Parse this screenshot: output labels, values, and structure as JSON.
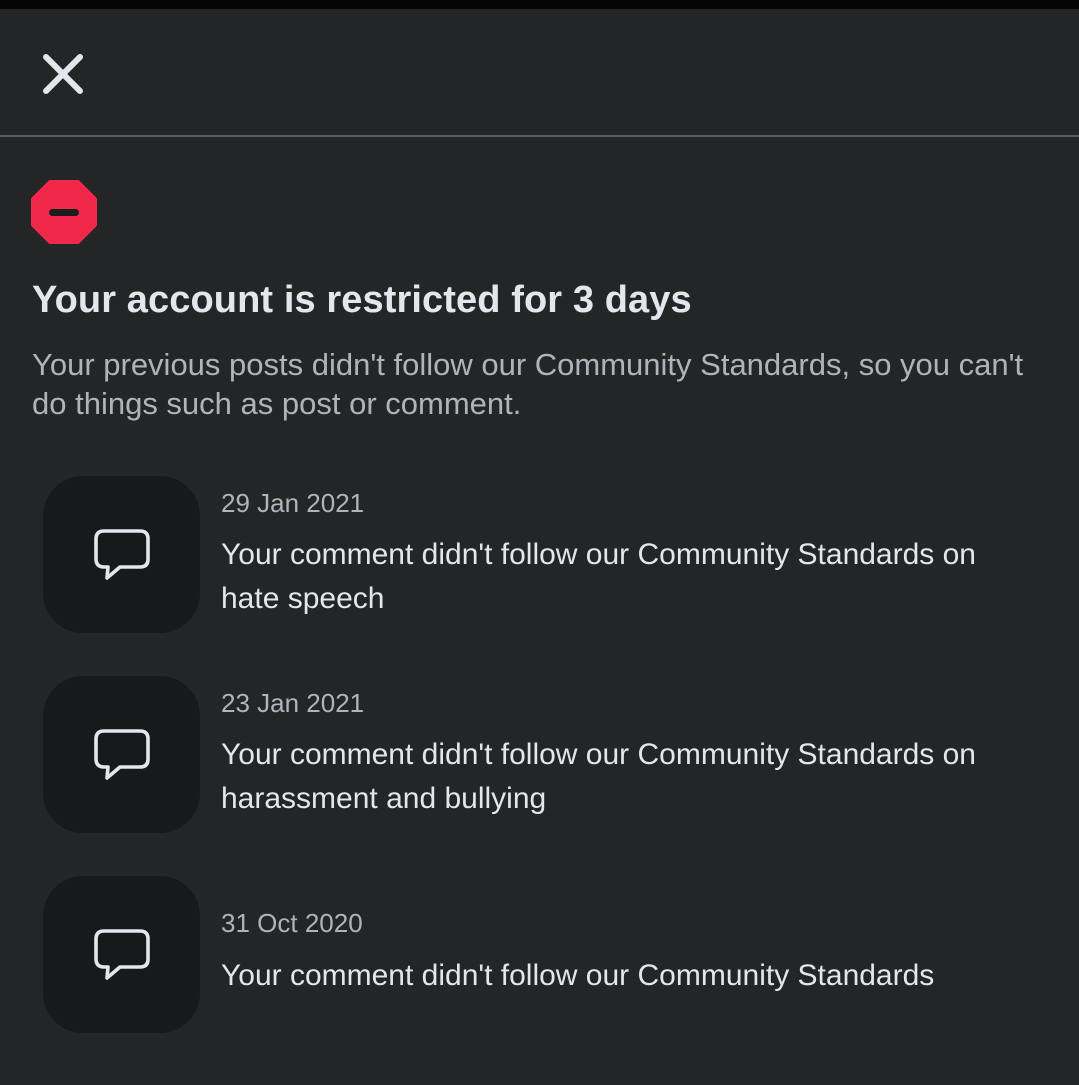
{
  "header": {
    "close_icon": "close-icon"
  },
  "colors": {
    "background": "#242526",
    "restrict_red": "#f02849",
    "primary_text": "#e4e6eb",
    "secondary_text": "#b0b3b8",
    "icon_box": "#18191a"
  },
  "restriction": {
    "icon": "restricted-icon",
    "title": "Your account is restricted for 3 days",
    "description": "Your previous posts didn't follow our Community Standards, so you can't do things such as post or comment."
  },
  "violations": [
    {
      "icon": "comment-icon",
      "date": "29 Jan 2021",
      "text": "Your comment didn't follow our Community Standards on hate speech"
    },
    {
      "icon": "comment-icon",
      "date": "23 Jan 2021",
      "text": "Your comment didn't follow our Community Standards on harassment and bullying"
    },
    {
      "icon": "comment-icon",
      "date": "31 Oct 2020",
      "text": "Your comment didn't follow our Community Standards"
    }
  ]
}
